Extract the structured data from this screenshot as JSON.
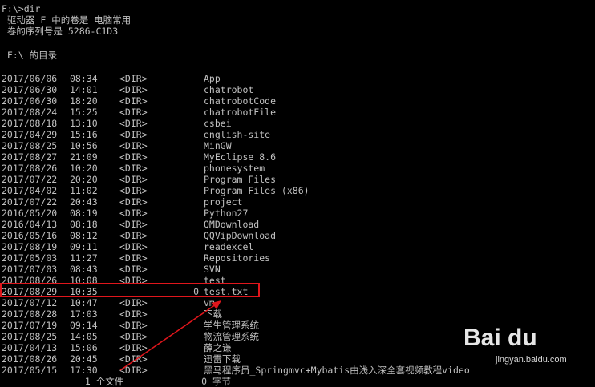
{
  "header": {
    "prompt_line": "F:\\>dir",
    "volume_line": " 驱动器 F 中的卷是 电脑常用",
    "serial_line": " 卷的序列号是 5286-C1D3",
    "directory_line": " F:\\ 的目录"
  },
  "listing": [
    {
      "date": "2017/06/06",
      "time": "08:34",
      "type": "<DIR>",
      "size": "",
      "name": "App"
    },
    {
      "date": "2017/06/30",
      "time": "14:01",
      "type": "<DIR>",
      "size": "",
      "name": "chatrobot"
    },
    {
      "date": "2017/06/30",
      "time": "18:20",
      "type": "<DIR>",
      "size": "",
      "name": "chatrobotCode"
    },
    {
      "date": "2017/08/24",
      "time": "15:25",
      "type": "<DIR>",
      "size": "",
      "name": "chatrobotFile"
    },
    {
      "date": "2017/08/18",
      "time": "13:10",
      "type": "<DIR>",
      "size": "",
      "name": "csbei"
    },
    {
      "date": "2017/04/29",
      "time": "15:16",
      "type": "<DIR>",
      "size": "",
      "name": "english-site"
    },
    {
      "date": "2017/08/25",
      "time": "10:56",
      "type": "<DIR>",
      "size": "",
      "name": "MinGW"
    },
    {
      "date": "2017/08/27",
      "time": "21:09",
      "type": "<DIR>",
      "size": "",
      "name": "MyEclipse 8.6"
    },
    {
      "date": "2017/08/26",
      "time": "10:20",
      "type": "<DIR>",
      "size": "",
      "name": "phonesystem"
    },
    {
      "date": "2017/07/22",
      "time": "20:20",
      "type": "<DIR>",
      "size": "",
      "name": "Program Files"
    },
    {
      "date": "2017/04/02",
      "time": "11:02",
      "type": "<DIR>",
      "size": "",
      "name": "Program Files (x86)"
    },
    {
      "date": "2017/07/22",
      "time": "20:43",
      "type": "<DIR>",
      "size": "",
      "name": "project"
    },
    {
      "date": "2016/05/20",
      "time": "08:19",
      "type": "<DIR>",
      "size": "",
      "name": "Python27"
    },
    {
      "date": "2016/04/13",
      "time": "08:18",
      "type": "<DIR>",
      "size": "",
      "name": "QMDownload"
    },
    {
      "date": "2016/05/16",
      "time": "08:12",
      "type": "<DIR>",
      "size": "",
      "name": "QQVipDownload"
    },
    {
      "date": "2017/08/19",
      "time": "09:11",
      "type": "<DIR>",
      "size": "",
      "name": "readexcel"
    },
    {
      "date": "2017/05/03",
      "time": "11:27",
      "type": "<DIR>",
      "size": "",
      "name": "Repositories"
    },
    {
      "date": "2017/07/03",
      "time": "08:43",
      "type": "<DIR>",
      "size": "",
      "name": "SVN"
    },
    {
      "date": "2017/08/26",
      "time": "10:08",
      "type": "<DIR>",
      "size": "",
      "name": "test"
    },
    {
      "date": "2017/08/29",
      "time": "10:35",
      "type": "",
      "size": "0",
      "name": "test.txt"
    },
    {
      "date": "2017/07/12",
      "time": "10:47",
      "type": "<DIR>",
      "size": "",
      "name": "vm"
    },
    {
      "date": "2017/08/28",
      "time": "17:03",
      "type": "<DIR>",
      "size": "",
      "name": "下载"
    },
    {
      "date": "2017/07/19",
      "time": "09:14",
      "type": "<DIR>",
      "size": "",
      "name": "学生管理系统"
    },
    {
      "date": "2017/08/25",
      "time": "14:05",
      "type": "<DIR>",
      "size": "",
      "name": "物流管理系统"
    },
    {
      "date": "2017/04/13",
      "time": "15:06",
      "type": "<DIR>",
      "size": "",
      "name": "薛之谦"
    },
    {
      "date": "2017/08/26",
      "time": "20:45",
      "type": "<DIR>",
      "size": "",
      "name": "迅雷下载"
    },
    {
      "date": "2017/05/15",
      "time": "17:30",
      "type": "<DIR>",
      "size": "",
      "name": "黑马程序员_Springmvc+Mybatis由浅入深全套视频教程video"
    }
  ],
  "summary_line": "               1 个文件              0 字节",
  "watermark": {
    "logo": "Bai du",
    "subtitle": "jingyan.baidu.com"
  },
  "colors": {
    "background": "#000000",
    "text": "#c0c0c0",
    "highlight": "#e0161c"
  }
}
